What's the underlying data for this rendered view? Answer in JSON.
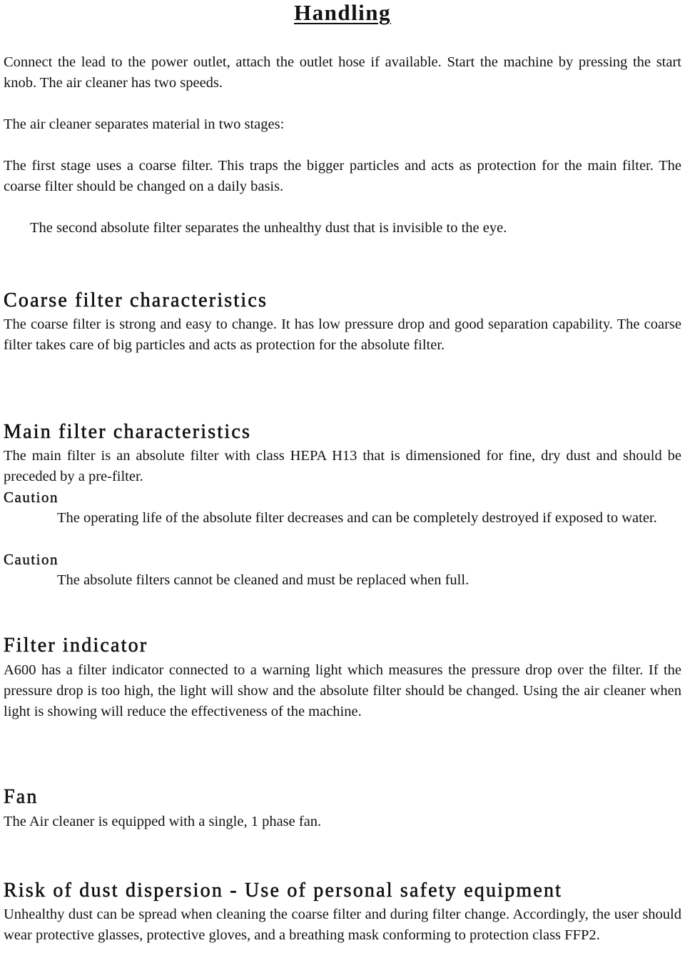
{
  "title": "Handling",
  "intro": {
    "p1": "Connect the lead to the power outlet, attach the outlet hose if available.  Start the machine by pressing the start knob. The air cleaner has two speeds.",
    "p2": "The air cleaner separates material in two stages:",
    "stage1": "The first stage uses a coarse filter. This traps the bigger particles and acts as protection for the main filter. The coarse filter should be changed on a daily basis.",
    "stage2": "The second absolute filter separates the unhealthy dust that is invisible to the eye."
  },
  "coarse": {
    "heading": "Coarse filter characteristics",
    "body": "The coarse filter is strong and easy to change.  It has low pressure drop and good separation capability.  The coarse filter takes care of big particles and acts as protection for the absolute filter."
  },
  "main": {
    "heading": "Main filter characteristics",
    "body": "The main filter is an absolute filter with class HEPA H13 that is dimensioned for fine, dry dust and should be preceded by a pre-filter.",
    "cautions": [
      {
        "label": "Caution",
        "text": "The operating life of the absolute filter decreases and can be completely destroyed if exposed to water."
      },
      {
        "label": "Caution",
        "text": "The absolute filters cannot be cleaned and must be replaced when full."
      }
    ]
  },
  "indicator": {
    "heading": "Filter indicator",
    "body": "A600 has a filter indicator connected to a warning light which measures the pressure drop over the filter. If the pressure drop is too high, the light will show and the absolute filter should be changed.  Using the air cleaner when light is showing will reduce the effectiveness of the machine."
  },
  "fan": {
    "heading": "Fan",
    "body": "The Air cleaner is equipped with a single, 1 phase fan."
  },
  "risk": {
    "heading": "Risk of dust dispersion - Use of personal safety equipment",
    "body": "Unhealthy dust can be spread when cleaning the coarse filter and during filter change. Accordingly, the user should wear protective glasses, protective gloves, and a breathing mask conforming to protection class FFP2."
  }
}
